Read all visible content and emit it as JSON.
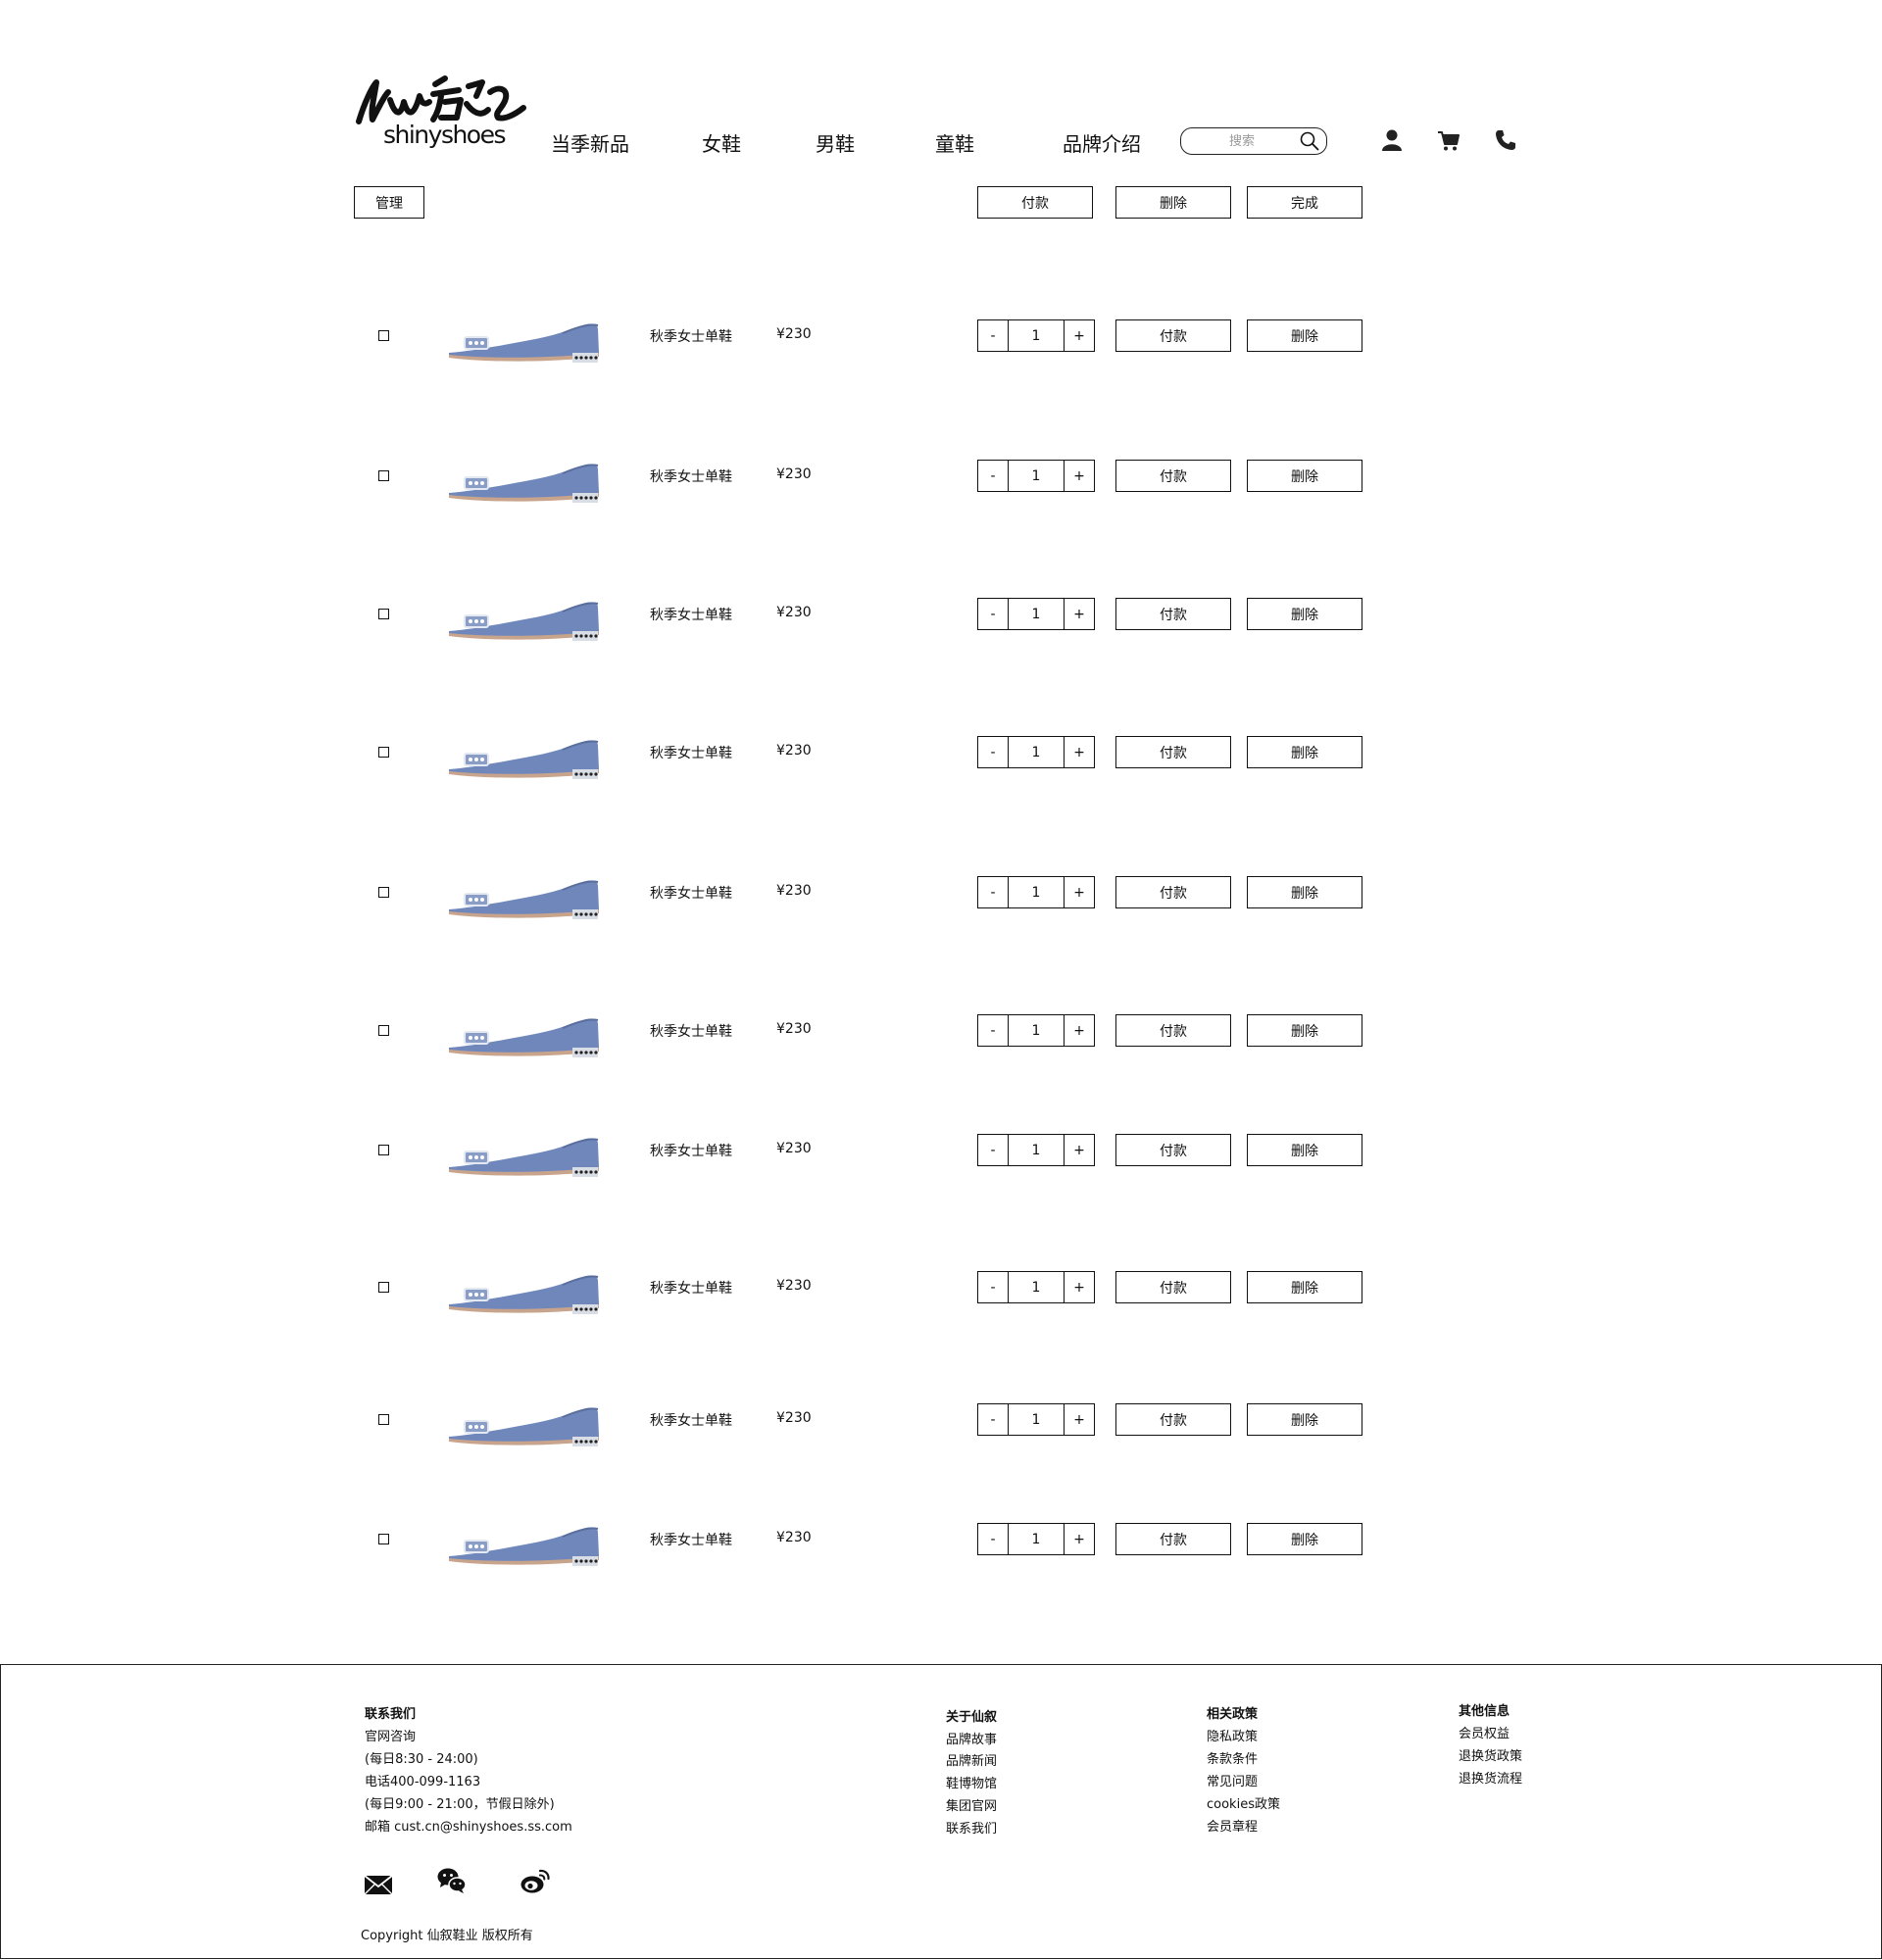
{
  "header": {
    "logo_text": "shinyshoes",
    "logo_script": "仙叙",
    "nav": [
      "当季新品",
      "女鞋",
      "男鞋",
      "童鞋",
      "品牌介绍"
    ],
    "search_placeholder": "搜索"
  },
  "toolbar": {
    "manage_label": "管理",
    "pay_label": "付款",
    "delete_label": "删除",
    "done_label": "完成"
  },
  "cart": {
    "items": [
      {
        "name": "秋季女士单鞋",
        "price": "¥230",
        "qty": "1",
        "minus": "-",
        "plus": "+",
        "pay": "付款",
        "delete": "删除"
      },
      {
        "name": "秋季女士单鞋",
        "price": "¥230",
        "qty": "1",
        "minus": "-",
        "plus": "+",
        "pay": "付款",
        "delete": "删除"
      },
      {
        "name": "秋季女士单鞋",
        "price": "¥230",
        "qty": "1",
        "minus": "-",
        "plus": "+",
        "pay": "付款",
        "delete": "删除"
      },
      {
        "name": "秋季女士单鞋",
        "price": "¥230",
        "qty": "1",
        "minus": "-",
        "plus": "+",
        "pay": "付款",
        "delete": "删除"
      },
      {
        "name": "秋季女士单鞋",
        "price": "¥230",
        "qty": "1",
        "minus": "-",
        "plus": "+",
        "pay": "付款",
        "delete": "删除"
      },
      {
        "name": "秋季女士单鞋",
        "price": "¥230",
        "qty": "1",
        "minus": "-",
        "plus": "+",
        "pay": "付款",
        "delete": "删除"
      },
      {
        "name": "秋季女士单鞋",
        "price": "¥230",
        "qty": "1",
        "minus": "-",
        "plus": "+",
        "pay": "付款",
        "delete": "删除"
      },
      {
        "name": "秋季女士单鞋",
        "price": "¥230",
        "qty": "1",
        "minus": "-",
        "plus": "+",
        "pay": "付款",
        "delete": "删除"
      },
      {
        "name": "秋季女士单鞋",
        "price": "¥230",
        "qty": "1",
        "minus": "-",
        "plus": "+",
        "pay": "付款",
        "delete": "删除"
      },
      {
        "name": "秋季女士单鞋",
        "price": "¥230",
        "qty": "1",
        "minus": "-",
        "plus": "+",
        "pay": "付款",
        "delete": "删除"
      }
    ]
  },
  "footer": {
    "contact": {
      "title": "联系我们",
      "lines": [
        "官网咨询",
        "(每日8:30 - 24:00)",
        "电话400-099-1163",
        "(每日9:00 - 21:00，节假日除外)",
        "邮箱 cust.cn@shinyshoes.ss.com"
      ]
    },
    "about": {
      "title": "关于仙叙",
      "links": [
        "品牌故事",
        "品牌新闻",
        "鞋博物馆",
        "集团官网",
        "联系我们"
      ]
    },
    "policy": {
      "title": "相关政策",
      "links": [
        "隐私政策",
        "条款条件",
        "常见问题",
        "cookies政策",
        "会员章程"
      ]
    },
    "other": {
      "title": "其他信息",
      "links": [
        "会员权益",
        "退换货政策",
        "退换货流程"
      ]
    },
    "social_icons": [
      "mail-icon",
      "wechat-icon",
      "weibo-icon"
    ],
    "copyright": "Copyright 仙叙鞋业 版权所有"
  },
  "colors": {
    "background": "#ffffff",
    "text": "#111111",
    "shoe": "#6f87bb",
    "border": "#222222"
  }
}
